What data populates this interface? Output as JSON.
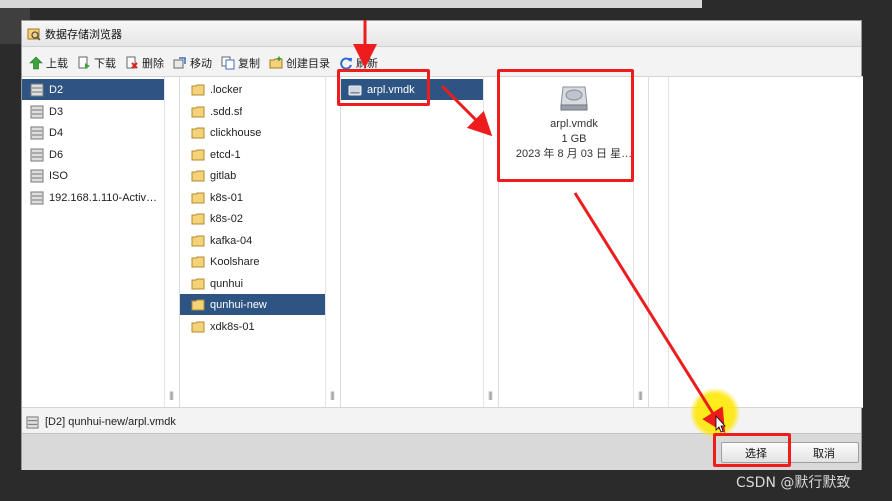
{
  "window": {
    "title": "数据存储浏览器"
  },
  "toolbar": {
    "upload": "上载",
    "download": "下载",
    "delete": "删除",
    "move": "移动",
    "copy": "复制",
    "mkdir": "创建目录",
    "refresh": "刷新"
  },
  "datastores": [
    {
      "label": "D2",
      "selected": true
    },
    {
      "label": "D3"
    },
    {
      "label": "D4"
    },
    {
      "label": "D6"
    },
    {
      "label": "ISO"
    },
    {
      "label": "192.168.1.110-Activ…"
    }
  ],
  "folders": [
    {
      "label": ".locker"
    },
    {
      "label": ".sdd.sf"
    },
    {
      "label": "clickhouse"
    },
    {
      "label": "etcd-1"
    },
    {
      "label": "gitlab"
    },
    {
      "label": "k8s-01"
    },
    {
      "label": "k8s-02"
    },
    {
      "label": "kafka-04"
    },
    {
      "label": "Koolshare"
    },
    {
      "label": "qunhui"
    },
    {
      "label": "qunhui-new",
      "selected": true
    },
    {
      "label": "xdk8s-01"
    }
  ],
  "files": [
    {
      "label": "arpl.vmdk",
      "selected": true
    }
  ],
  "details": {
    "name": "arpl.vmdk",
    "size": "1 GB",
    "date": "2023 年 8 月 03 日 星…"
  },
  "status": {
    "path": "[D2] qunhui-new/arpl.vmdk"
  },
  "buttons": {
    "select": "选择",
    "cancel": "取消"
  },
  "watermark": "CSDN @默行默致",
  "colors": {
    "selection": "#2e5483",
    "annotation": "#ee1c1c",
    "cursor_highlight": "#ffe600"
  }
}
